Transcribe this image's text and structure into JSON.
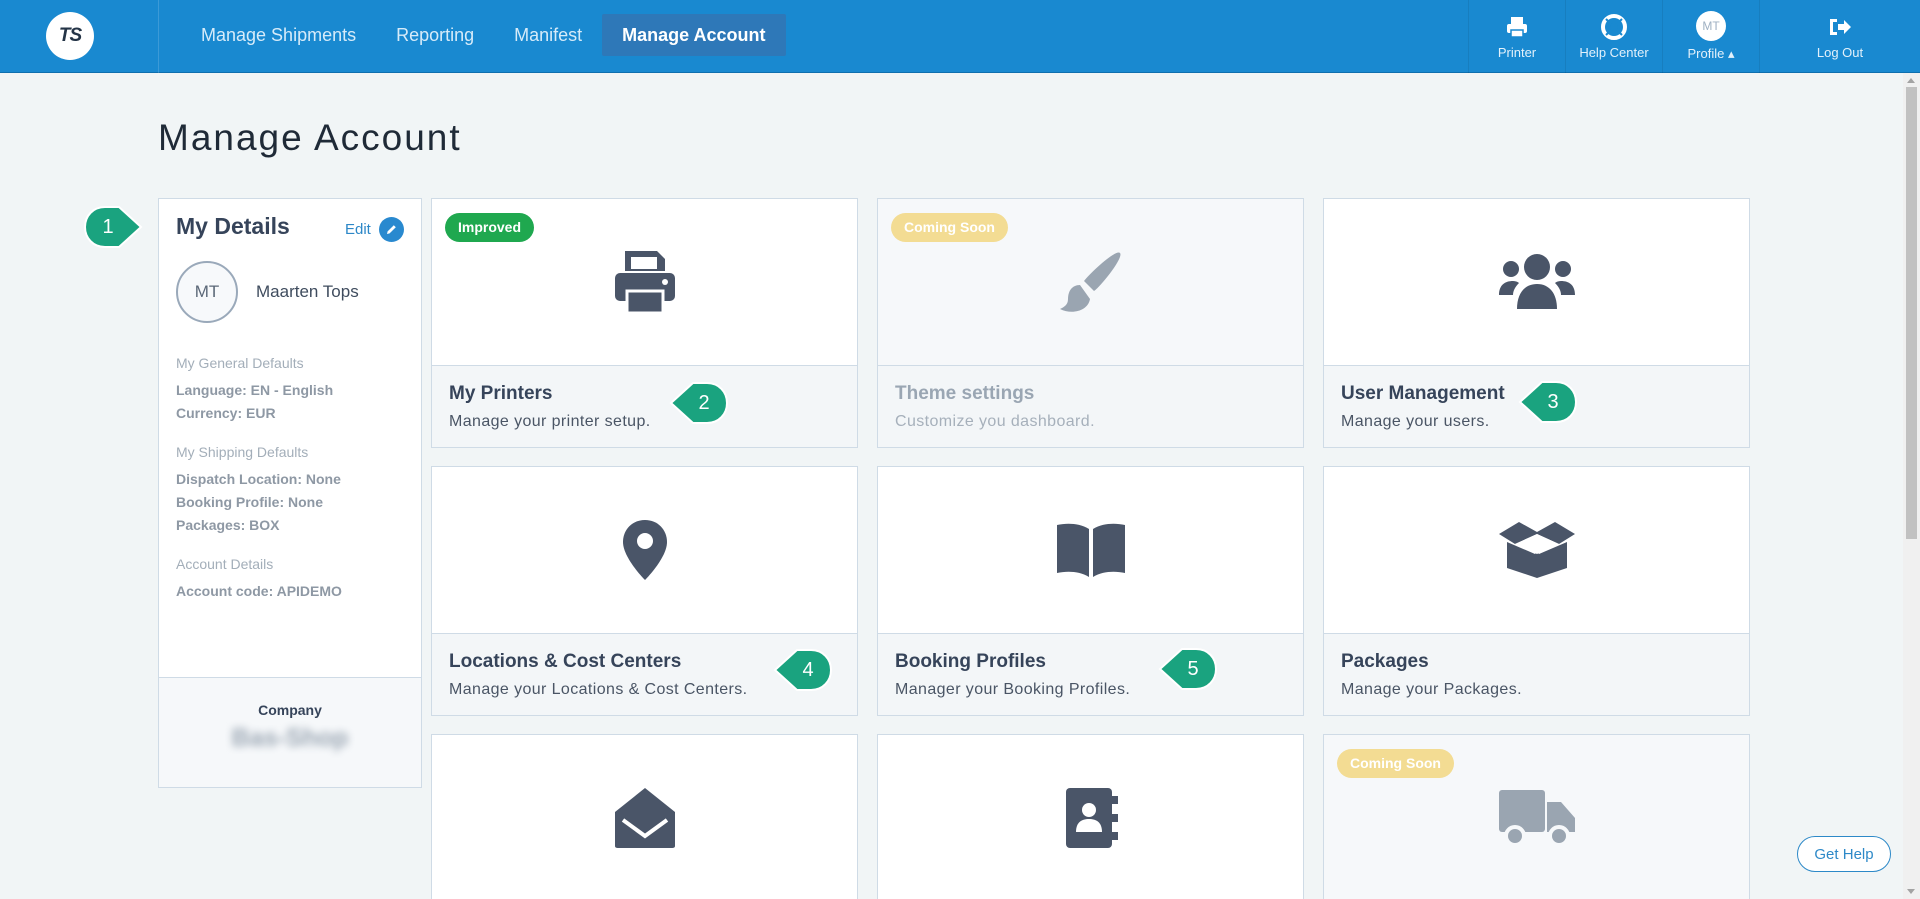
{
  "logo": {
    "text": "TS"
  },
  "nav": {
    "items": [
      {
        "label": "Manage Shipments"
      },
      {
        "label": "Reporting"
      },
      {
        "label": "Manifest"
      },
      {
        "label": "Manage Account"
      }
    ],
    "active": "Manage Account"
  },
  "tools": {
    "printer": "Printer",
    "help_center": "Help Center",
    "profile": "Profile ▴",
    "profile_initials": "MT",
    "logout": "Log Out"
  },
  "page": {
    "title": "Manage Account"
  },
  "details": {
    "heading": "My Details",
    "edit": "Edit",
    "initials": "MT",
    "name": "Maarten Tops",
    "general_defaults_label": "My General Defaults",
    "language": "Language: EN - English",
    "currency": "Currency: EUR",
    "shipping_defaults_label": "My Shipping Defaults",
    "dispatch": "Dispatch Location: None",
    "booking": "Booking Profile: None",
    "packages": "Packages: BOX",
    "account_label": "Account Details",
    "account_code": "Account code: APIDEMO",
    "company_label": "Company",
    "company_name": "Bas-Shop"
  },
  "cards": [
    {
      "title": "My Printers",
      "desc": "Manage your printer setup.",
      "badge": "Improved",
      "icon": "printer-icon"
    },
    {
      "title": "Theme settings",
      "desc": "Customize you dashboard.",
      "badge": "Coming Soon",
      "icon": "paintbrush-icon"
    },
    {
      "title": "User Management",
      "desc": "Manage your users.",
      "badge": "",
      "icon": "users-icon"
    },
    {
      "title": "Locations & Cost Centers",
      "desc": "Manage your Locations & Cost Centers.",
      "badge": "",
      "icon": "map-marker-icon"
    },
    {
      "title": "Booking Profiles",
      "desc": "Manager your Booking Profiles.",
      "badge": "",
      "icon": "book-open-icon"
    },
    {
      "title": "Packages",
      "desc": "Manage your Packages.",
      "badge": "",
      "icon": "box-open-icon"
    },
    {
      "title": "",
      "desc": "",
      "badge": "",
      "icon": "envelope-open-icon"
    },
    {
      "title": "",
      "desc": "",
      "badge": "",
      "icon": "address-book-icon"
    },
    {
      "title": "",
      "desc": "",
      "badge": "Coming Soon",
      "icon": "truck-icon"
    }
  ],
  "steps": [
    "1",
    "2",
    "3",
    "4",
    "5"
  ],
  "help": {
    "label": "Get Help"
  },
  "colors": {
    "topbar": "#1989d0",
    "active_nav": "#2e78b8",
    "improved_badge": "#1fa84f",
    "coming_soon_badge": "#f3dc93",
    "step_marker": "#1aa37f",
    "icon": "#4a5568"
  }
}
